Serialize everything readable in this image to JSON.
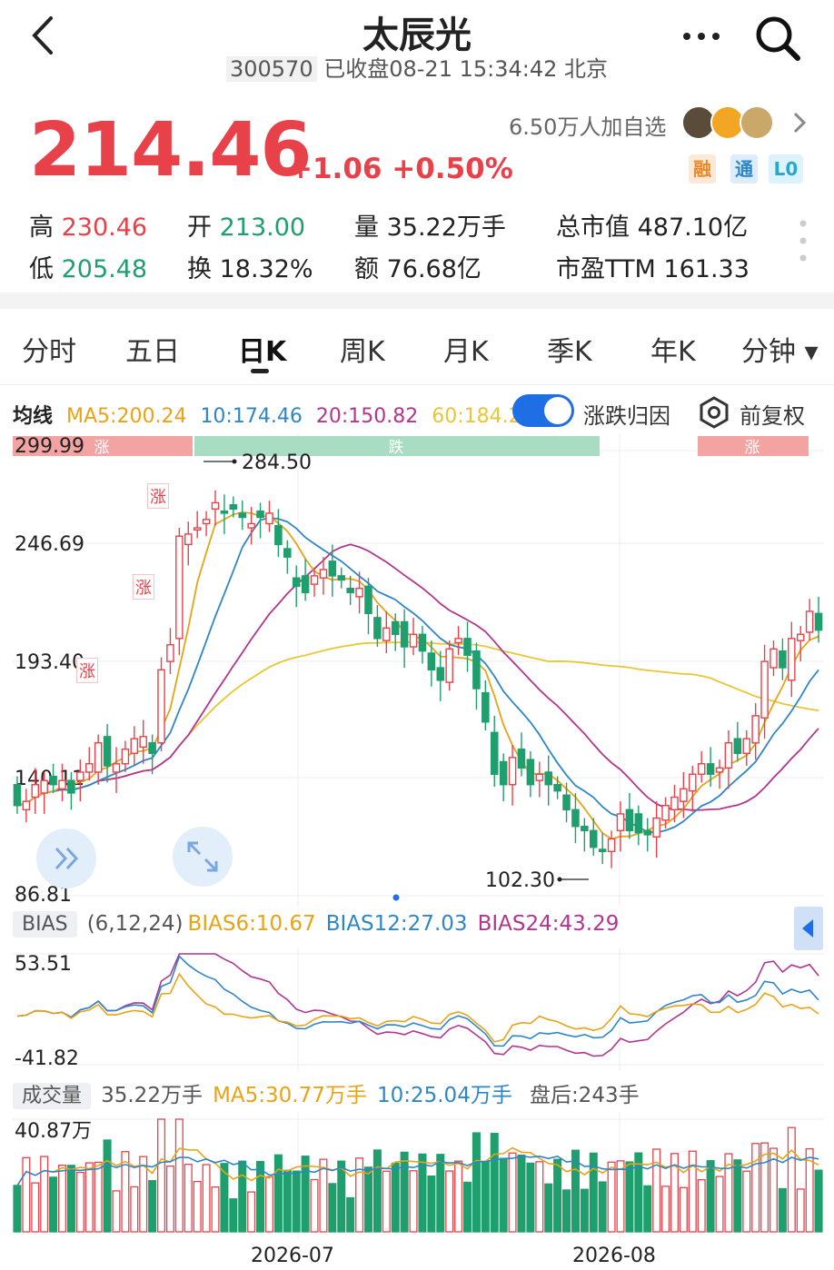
{
  "header": {
    "title": "太辰光",
    "code": "300570",
    "status_time": "已收盘08-21 15:34:42 北京"
  },
  "quote": {
    "price": "214.46",
    "change": "+1.06 +0.50%",
    "watchers": "6.50万人加自选",
    "badges": [
      "融",
      "通",
      "L0"
    ],
    "stats": [
      {
        "label": "高",
        "value": "230.46",
        "color": "red"
      },
      {
        "label": "开",
        "value": "213.00",
        "color": "green"
      },
      {
        "label": "量",
        "value": "35.22万手",
        "color": "dark"
      },
      {
        "label": "总市值",
        "value": "487.10亿",
        "color": "dark"
      },
      {
        "label": "低",
        "value": "205.48",
        "color": "green"
      },
      {
        "label": "换",
        "value": "18.32%",
        "color": "dark"
      },
      {
        "label": "额",
        "value": "76.68亿",
        "color": "dark"
      },
      {
        "label": "市盈TTM",
        "value": "161.33",
        "color": "dark"
      }
    ]
  },
  "tabs": [
    {
      "label": "分时",
      "active": false
    },
    {
      "label": "五日",
      "active": false
    },
    {
      "label": "日K",
      "active": true
    },
    {
      "label": "周K",
      "active": false
    },
    {
      "label": "月K",
      "active": false
    },
    {
      "label": "季K",
      "active": false
    },
    {
      "label": "年K",
      "active": false
    },
    {
      "label": "分钟",
      "active": false
    }
  ],
  "ma_bar": {
    "label": "均线",
    "ma5": "MA5:200.24",
    "ma10": "10:174.46",
    "ma20": "20:150.82",
    "ma60": "60:184.24",
    "toggle_label": "涨跌归因",
    "adjust_label": "前复权"
  },
  "colors": {
    "up": "#e8414a",
    "down": "#1f9e6e",
    "ma5": "#e8a317",
    "ma10": "#2f86c7",
    "ma20": "#b2358f",
    "ma60": "#e8c637",
    "accent": "#1e6fe6"
  },
  "price_chart": {
    "y_labels": [
      "299.99",
      "246.69",
      "193.40",
      "140.11",
      "86.81"
    ],
    "high_label": "284.50",
    "low_label": "102.30",
    "band_labels": [
      "涨",
      "跌",
      "涨"
    ],
    "tag_label": "涨"
  },
  "bias": {
    "label": "BIAS",
    "params": "(6,12,24)",
    "bias6": "BIAS6:10.67",
    "bias12": "BIAS12:27.03",
    "bias24": "BIAS24:43.29",
    "y_top": "53.51",
    "y_bottom": "-41.82"
  },
  "volume": {
    "label": "成交量",
    "value": "35.22万手",
    "ma5": "MA5:30.77万手",
    "ma10": "10:25.04万手",
    "after": "盘后:243手",
    "y_top": "40.87万"
  },
  "x_labels": [
    "2026-07",
    "2026-08"
  ],
  "chart_data": {
    "type": "candlestick",
    "closes": [
      130,
      132,
      140,
      142,
      140,
      142,
      136,
      146,
      150,
      160,
      149,
      150,
      157,
      162,
      163,
      155,
      195,
      207,
      259,
      260,
      263,
      267,
      275,
      270,
      272,
      268,
      265,
      268,
      270,
      255,
      249,
      235,
      232,
      240,
      243,
      240,
      238,
      232,
      234,
      222,
      210,
      215,
      212,
      206,
      212,
      204,
      195,
      190,
      205,
      210,
      202,
      186,
      170,
      145,
      140,
      153,
      148,
      140,
      145,
      140,
      137,
      128,
      120,
      118,
      110,
      108,
      114,
      126,
      118,
      117,
      116,
      124,
      130,
      134,
      138,
      145,
      150,
      145,
      148,
      160,
      155,
      162,
      173,
      199,
      205,
      196,
      210,
      212,
      223,
      214
    ],
    "opens": [
      140,
      128,
      134,
      136,
      144,
      138,
      142,
      142,
      146,
      146,
      163,
      146,
      150,
      155,
      158,
      160,
      160,
      199,
      210,
      255,
      262,
      265,
      272,
      271,
      274,
      270,
      263,
      271,
      265,
      264,
      253,
      239,
      240,
      236,
      239,
      247,
      240,
      234,
      230,
      235,
      220,
      209,
      218,
      218,
      206,
      212,
      203,
      196,
      189,
      208,
      210,
      204,
      184,
      165,
      151,
      140,
      157,
      152,
      142,
      146,
      140,
      135,
      128,
      120,
      118,
      109,
      108,
      118,
      128,
      126,
      118,
      115,
      123,
      128,
      132,
      137,
      145,
      150,
      146,
      148,
      162,
      155,
      160,
      172,
      196,
      204,
      190,
      209,
      213,
      222
    ],
    "y_range": [
      86.81,
      299.99
    ]
  }
}
